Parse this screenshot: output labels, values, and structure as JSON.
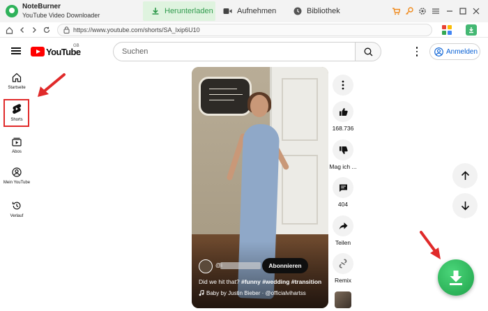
{
  "app": {
    "name": "NoteBurner",
    "subtitle": "YouTube Video Downloader",
    "tabs": [
      {
        "label": "Herunterladen",
        "icon": "download-icon",
        "active": true
      },
      {
        "label": "Aufnehmen",
        "icon": "record-icon",
        "active": false
      },
      {
        "label": "Bibliothek",
        "icon": "library-icon",
        "active": false
      }
    ],
    "accent_color": "#2f9a4c"
  },
  "browser": {
    "url": "https://www.youtube.com/shorts/SA_lxip6U10"
  },
  "youtube": {
    "wordmark": "YouTube",
    "region": "GB",
    "search_placeholder": "Suchen",
    "signin_label": "Anmelden",
    "guide": [
      {
        "label": "Startseite",
        "icon": "home-icon"
      },
      {
        "label": "Shorts",
        "icon": "shorts-icon",
        "selected": true
      },
      {
        "label": "Abos",
        "icon": "subscriptions-icon"
      },
      {
        "label": "Mein YouTube",
        "icon": "account-icon"
      },
      {
        "label": "Verlauf",
        "icon": "history-icon"
      }
    ]
  },
  "short": {
    "channel_prefix": "@i",
    "subscribe_label": "Abonnieren",
    "title_text": "Did we hit that?",
    "hashtags": "#funny #wedding #transition",
    "music": "Baby by Justin Bieber · @officialvihartss"
  },
  "rail": {
    "likes": "168.736",
    "dislike": "Mag ich ...",
    "comments": "404",
    "share": "Teilen",
    "remix": "Remix"
  }
}
